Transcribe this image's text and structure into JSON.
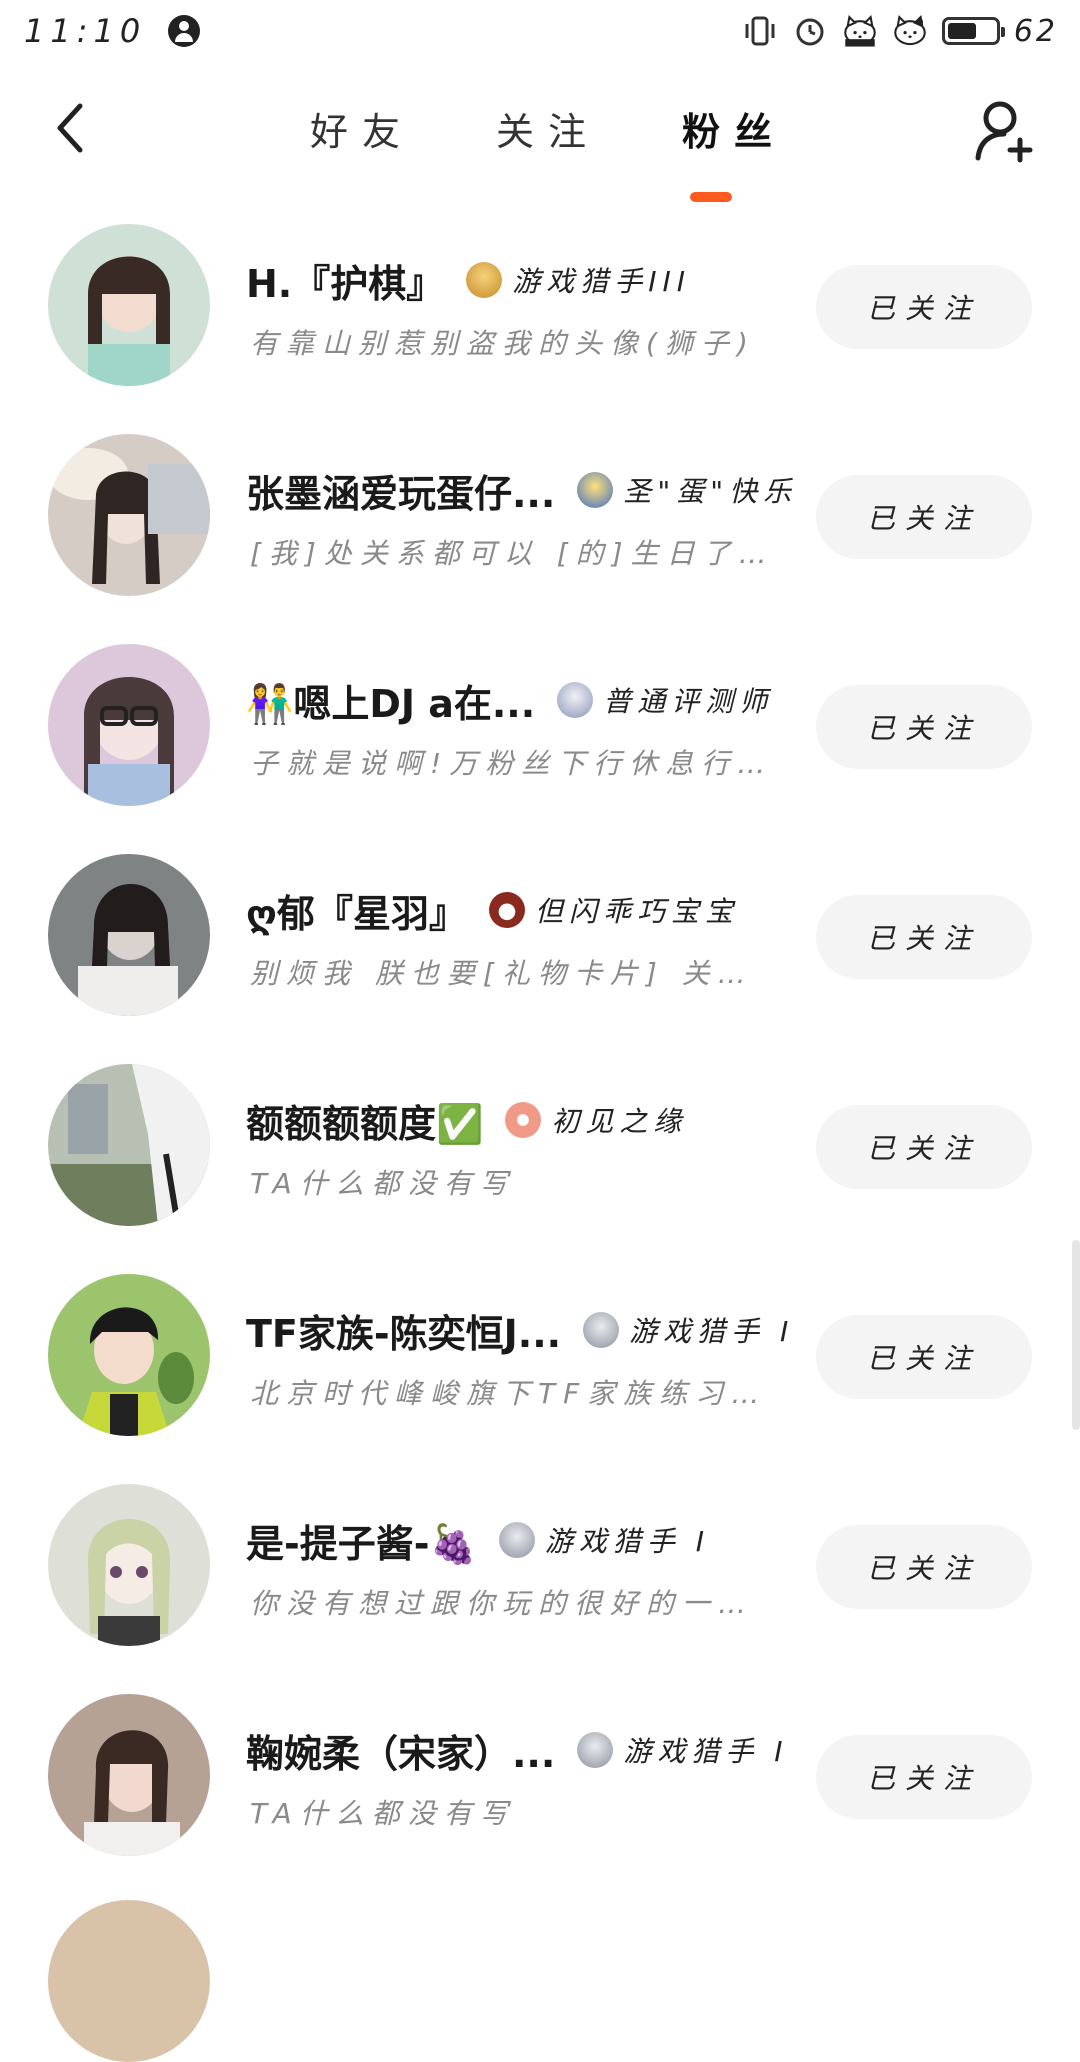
{
  "status_bar": {
    "time": "11:10",
    "battery": "62",
    "icons": [
      "vibrate-icon",
      "alarm-icon",
      "hello-kitty-icon",
      "hello-kitty-icon"
    ]
  },
  "header": {
    "back_icon": "chevron-left-icon",
    "tabs": [
      {
        "label": "好友",
        "active": false
      },
      {
        "label": "关注",
        "active": false
      },
      {
        "label": "粉丝",
        "active": true
      }
    ],
    "add_friend_icon": "add-user-icon",
    "accent_color": "#ff5a1f"
  },
  "fans": [
    {
      "name": "H.『护棋』",
      "badge_color": "#e0a83a",
      "badge": "游戏猎手III",
      "sign": "有靠山别惹别盗我的头像(狮子)",
      "button": "已关注",
      "avatar_color": "#c9d9d0"
    },
    {
      "name": "张墨涵爱玩蛋仔...",
      "badge_color": "#4a7bd0",
      "badge": "圣\"蛋\"快乐",
      "sign": "[我]处关系都可以 [的]生日了…",
      "button": "已关注",
      "avatar_color": "#d9c9c2"
    },
    {
      "name": "👫嗯上DJ a在...",
      "badge_color": "#9aa6c4",
      "badge": "普通评测师",
      "sign": "子就是说啊!万粉丝下行休息行…",
      "button": "已关注",
      "avatar_color": "#d9c2d6"
    },
    {
      "name": "ღ郁『星羽』",
      "badge_color": "#8a2a1e",
      "badge": "但闪乖巧宝宝",
      "sign": "别烦我 朕也要[礼物卡片] 关…",
      "button": "已关注",
      "avatar_color": "#8e8e8e"
    },
    {
      "name": "额额额额度✅",
      "badge_color": "#f29a88",
      "badge": "初见之缘",
      "sign": "TA什么都没有写",
      "button": "已关注",
      "avatar_color": "#9aa590"
    },
    {
      "name": "TF家族-陈奕恒J...",
      "badge_color": "#9fa3ad",
      "badge": "游戏猎手 I",
      "sign": "北京时代峰峻旗下TF家族练习…",
      "button": "已关注",
      "avatar_color": "#95b86a"
    },
    {
      "name": "是-提子酱-🍇",
      "badge_color": "#9fa3ad",
      "badge": "游戏猎手 I",
      "sign": "你没有想过跟你玩的很好的一…",
      "button": "已关注",
      "avatar_color": "#d8d8cc"
    },
    {
      "name": "鞠婉柔（宋家）...",
      "badge_color": "#9fa3ad",
      "badge": "游戏猎手 I",
      "sign": "TA什么都没有写",
      "button": "已关注",
      "avatar_color": "#b9a49a"
    }
  ]
}
